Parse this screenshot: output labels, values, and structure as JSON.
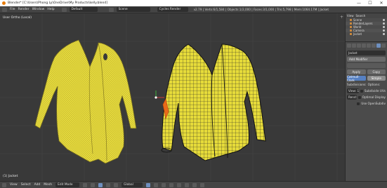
{
  "window": {
    "title": "Blender* [C:\\Users\\Phong Ly\\OneDrive\\My Products\\kelly.blend]",
    "minimize": "—",
    "maximize": "☐",
    "close": "✕"
  },
  "info_header": {
    "menus": [
      "File",
      "Render",
      "Window",
      "Help"
    ],
    "layout": "Default",
    "scene": "Scene",
    "engine": "Cycles Render",
    "stats": "v2.79 | Verts:6/1,584 | Objects:1/2,000 | Faces:3/1,000 | Tris:5,798 | Mem:1064.17M | Jacket"
  },
  "viewport": {
    "view_label": "User Ortho (Local)",
    "object_label": "(1) Jacket",
    "tools_glyph": "+"
  },
  "outliner": {
    "header": [
      "View",
      "Search"
    ],
    "rows": [
      "Scene",
      "RenderLayers",
      "World",
      "Camera",
      "Jacket"
    ]
  },
  "properties": {
    "object_name": "Jacket",
    "add_modifier": "Add Modifier",
    "apply": "Apply",
    "copy": "Copy",
    "catmull_clark": "Catmull-Clark",
    "simple": "Simple",
    "subdivisions": "Subdivisions:",
    "options": "Options:",
    "view": "View: 1",
    "render": "Rend: 2",
    "subdivide_uvs": "Subdivide UVs",
    "optimal_display": "Optimal Display",
    "use_opensubdiv": "Use OpenSubdiv"
  },
  "bottom_header": {
    "menus": [
      "View",
      "Select",
      "Add",
      "Mesh"
    ],
    "mode": "Edit Mode",
    "pivot": "Global"
  },
  "colors": {
    "viewport_bg": "#393939",
    "cloth_yellow": "#e6dc3c",
    "selected_edge": "#e86a1a",
    "active_button": "#5680c2"
  }
}
